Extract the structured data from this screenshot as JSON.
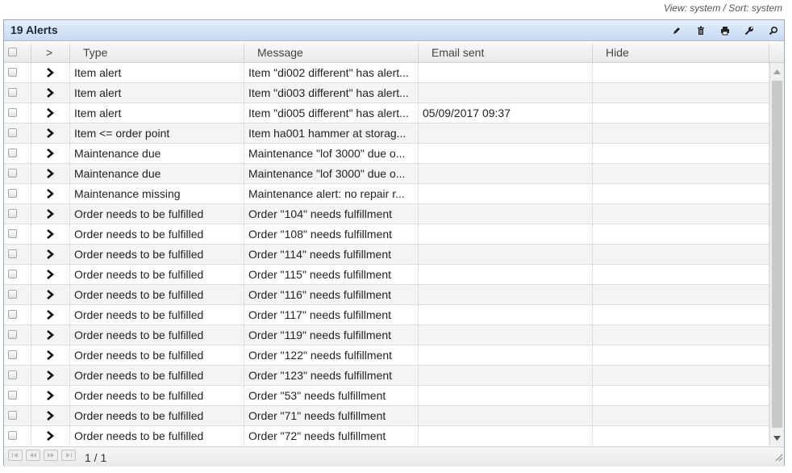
{
  "view_info": "View: system / Sort: system",
  "panel": {
    "title": "19 Alerts",
    "tools": [
      "edit-icon",
      "delete-icon",
      "print-icon",
      "settings-icon",
      "search-icon"
    ]
  },
  "columns": {
    "expand": ">",
    "type": "Type",
    "message": "Message",
    "email_sent": "Email sent",
    "hide": "Hide"
  },
  "rows": [
    {
      "type": "Item alert",
      "message": "Item \"di002 different\" has alert...",
      "email_sent": "",
      "hide": ""
    },
    {
      "type": "Item alert",
      "message": "Item \"di003 different\" has alert...",
      "email_sent": "",
      "hide": ""
    },
    {
      "type": "Item alert",
      "message": "Item \"di005 different\" has alert...",
      "email_sent": "05/09/2017 09:37",
      "hide": ""
    },
    {
      "type": "Item <= order point",
      "message": "Item ha001 hammer at storag...",
      "email_sent": "",
      "hide": ""
    },
    {
      "type": "Maintenance due",
      "message": "Maintenance \"lof 3000\" due o...",
      "email_sent": "",
      "hide": ""
    },
    {
      "type": "Maintenance due",
      "message": "Maintenance \"lof 3000\" due o...",
      "email_sent": "",
      "hide": ""
    },
    {
      "type": "Maintenance missing",
      "message": "Maintenance alert: no repair r...",
      "email_sent": "",
      "hide": ""
    },
    {
      "type": "Order needs to be fulfilled",
      "message": "Order \"104\" needs fulfillment",
      "email_sent": "",
      "hide": ""
    },
    {
      "type": "Order needs to be fulfilled",
      "message": "Order \"108\" needs fulfillment",
      "email_sent": "",
      "hide": ""
    },
    {
      "type": "Order needs to be fulfilled",
      "message": "Order \"114\" needs fulfillment",
      "email_sent": "",
      "hide": ""
    },
    {
      "type": "Order needs to be fulfilled",
      "message": "Order \"115\" needs fulfillment",
      "email_sent": "",
      "hide": ""
    },
    {
      "type": "Order needs to be fulfilled",
      "message": "Order \"116\" needs fulfillment",
      "email_sent": "",
      "hide": ""
    },
    {
      "type": "Order needs to be fulfilled",
      "message": "Order \"117\" needs fulfillment",
      "email_sent": "",
      "hide": ""
    },
    {
      "type": "Order needs to be fulfilled",
      "message": "Order \"119\" needs fulfillment",
      "email_sent": "",
      "hide": ""
    },
    {
      "type": "Order needs to be fulfilled",
      "message": "Order \"122\" needs fulfillment",
      "email_sent": "",
      "hide": ""
    },
    {
      "type": "Order needs to be fulfilled",
      "message": "Order \"123\" needs fulfillment",
      "email_sent": "",
      "hide": ""
    },
    {
      "type": "Order needs to be fulfilled",
      "message": "Order \"53\" needs fulfillment",
      "email_sent": "",
      "hide": ""
    },
    {
      "type": "Order needs to be fulfilled",
      "message": "Order \"71\" needs fulfillment",
      "email_sent": "",
      "hide": ""
    },
    {
      "type": "Order needs to be fulfilled",
      "message": "Order \"72\" needs fulfillment",
      "email_sent": "",
      "hide": ""
    }
  ],
  "pager": {
    "page_info": "1 / 1",
    "buttons": [
      "first-page-icon",
      "prev-page-icon",
      "next-page-icon",
      "last-page-icon"
    ]
  }
}
